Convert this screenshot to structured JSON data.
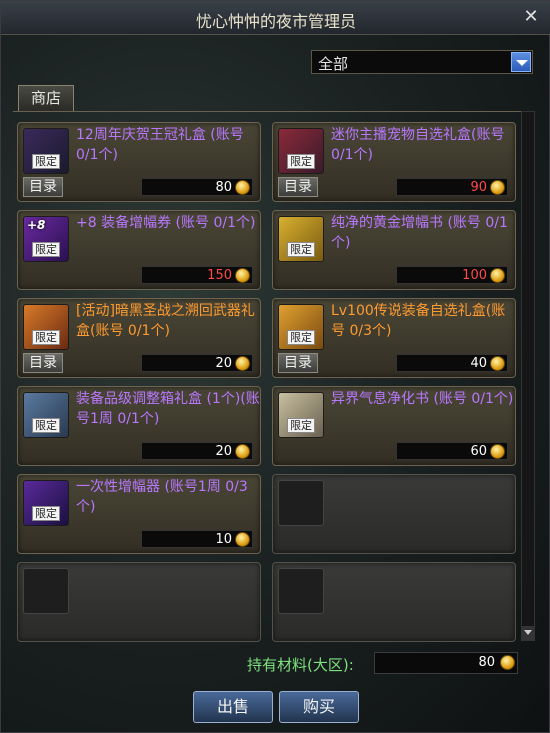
{
  "window": {
    "title": "忧心忡忡的夜市管理员"
  },
  "filter": {
    "value": "全部"
  },
  "tabs": [
    {
      "label": "商店"
    }
  ],
  "catalog_label": "目录",
  "limited_label": "限定",
  "colors": {
    "purple": "#b877ff",
    "orange": "#ff9a2e",
    "white_price": "#ffffff",
    "red_price": "#ff4a4a",
    "material": "#7fe07f"
  },
  "items": [
    {
      "name": "12周年庆贺王冠礼盒 (账号 0/1个)",
      "price": "80",
      "name_color": "#b877ff",
      "price_color": "#ffffff",
      "limited": true,
      "catalog": true,
      "icon": "crown-gift-icon",
      "plus": ""
    },
    {
      "name": "迷你主播宠物自选礼盒(账号 0/1个)",
      "price": "90",
      "name_color": "#b877ff",
      "price_color": "#ff4a4a",
      "limited": true,
      "catalog": true,
      "icon": "pet-gift-icon",
      "plus": ""
    },
    {
      "name": "+8 装备增幅券 (账号 0/1个)",
      "price": "150",
      "name_color": "#b877ff",
      "price_color": "#ff4a4a",
      "limited": true,
      "catalog": false,
      "icon": "amplify-ticket-icon",
      "plus": "+8"
    },
    {
      "name": "纯净的黄金增幅书 (账号 0/1个)",
      "price": "100",
      "name_color": "#b877ff",
      "price_color": "#ff4a4a",
      "limited": true,
      "catalog": false,
      "icon": "gold-book-icon",
      "plus": ""
    },
    {
      "name": "[活动]暗黑圣战之溯回武器礼盒(账号 0/1个)",
      "price": "20",
      "name_color": "#ff9a2e",
      "price_color": "#ffffff",
      "limited": true,
      "catalog": true,
      "icon": "weapon-gift-icon",
      "plus": ""
    },
    {
      "name": "Lv100传说装备自选礼盒(账号 0/3个)",
      "price": "40",
      "name_color": "#ff9a2e",
      "price_color": "#ffffff",
      "limited": true,
      "catalog": true,
      "icon": "legend-gift-icon",
      "plus": ""
    },
    {
      "name": "装备品级调整箱礼盒 (1个)(账号1周 0/1个)",
      "price": "20",
      "name_color": "#b877ff",
      "price_color": "#ffffff",
      "limited": true,
      "catalog": false,
      "icon": "grade-box-icon",
      "plus": ""
    },
    {
      "name": "异界气息净化书 (账号 0/1个)",
      "price": "60",
      "name_color": "#b877ff",
      "price_color": "#ffffff",
      "limited": true,
      "catalog": false,
      "icon": "purify-book-icon",
      "plus": ""
    },
    {
      "name": "一次性增幅器 (账号1周 0/3个)",
      "price": "10",
      "name_color": "#b877ff",
      "price_color": "#ffffff",
      "limited": true,
      "catalog": false,
      "icon": "amplifier-icon",
      "plus": ""
    }
  ],
  "material": {
    "label": "持有材料(大区):",
    "value": "80"
  },
  "buttons": {
    "sell": "出售",
    "buy": "购买"
  }
}
